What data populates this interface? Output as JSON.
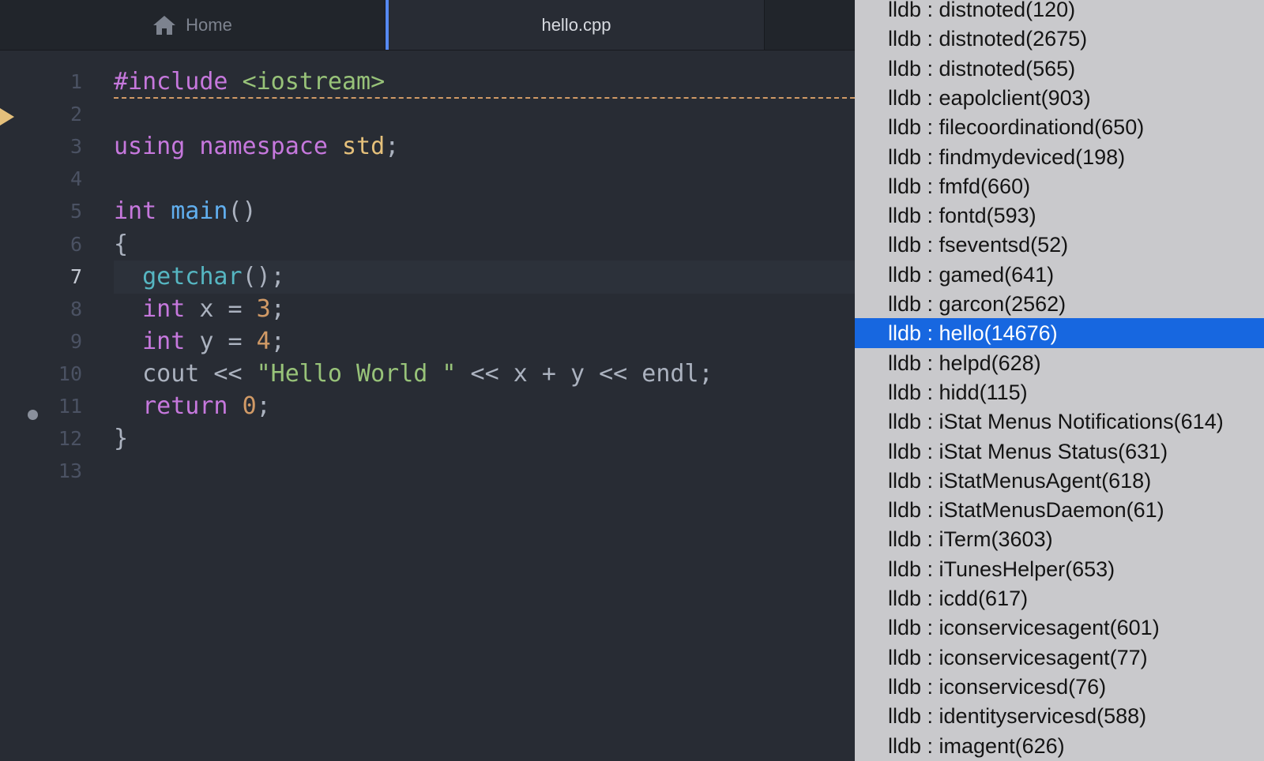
{
  "tabs": {
    "home_label": "Home",
    "file_label": "hello.cpp"
  },
  "editor": {
    "current_line": 7,
    "line_numbers": [
      "1",
      "2",
      "3",
      "4",
      "5",
      "6",
      "7",
      "8",
      "9",
      "10",
      "11",
      "12",
      "13"
    ],
    "lines": [
      [
        {
          "t": "#include ",
          "c": "kw"
        },
        {
          "t": "<iostream>",
          "c": "str"
        }
      ],
      [],
      [
        {
          "t": "using ",
          "c": "kw"
        },
        {
          "t": "namespace ",
          "c": "kw"
        },
        {
          "t": "std",
          "c": "ty"
        },
        {
          "t": ";",
          "c": "pl"
        }
      ],
      [],
      [
        {
          "t": "int ",
          "c": "kw"
        },
        {
          "t": "main",
          "c": "fn"
        },
        {
          "t": "()",
          "c": "pl"
        }
      ],
      [
        {
          "t": "{",
          "c": "pl"
        }
      ],
      [
        {
          "t": "  ",
          "c": "pl"
        },
        {
          "t": "getchar",
          "c": "bi"
        },
        {
          "t": "();",
          "c": "pl"
        }
      ],
      [
        {
          "t": "  ",
          "c": "pl"
        },
        {
          "t": "int",
          "c": "kw"
        },
        {
          "t": " x = ",
          "c": "pl"
        },
        {
          "t": "3",
          "c": "num"
        },
        {
          "t": ";",
          "c": "pl"
        }
      ],
      [
        {
          "t": "  ",
          "c": "pl"
        },
        {
          "t": "int",
          "c": "kw"
        },
        {
          "t": " y = ",
          "c": "pl"
        },
        {
          "t": "4",
          "c": "num"
        },
        {
          "t": ";",
          "c": "pl"
        }
      ],
      [
        {
          "t": "  cout << ",
          "c": "pl"
        },
        {
          "t": "\"Hello World \"",
          "c": "str"
        },
        {
          "t": " << x + y << endl;",
          "c": "pl"
        }
      ],
      [
        {
          "t": "  ",
          "c": "pl"
        },
        {
          "t": "return ",
          "c": "kw"
        },
        {
          "t": "0",
          "c": "num"
        },
        {
          "t": ";",
          "c": "pl"
        }
      ],
      [
        {
          "t": "}",
          "c": "pl"
        }
      ],
      []
    ]
  },
  "process_list": {
    "selected_index": 11,
    "items": [
      "lldb : distnoted(120)",
      "lldb : distnoted(2675)",
      "lldb : distnoted(565)",
      "lldb : eapolclient(903)",
      "lldb : filecoordinationd(650)",
      "lldb : findmydeviced(198)",
      "lldb : fmfd(660)",
      "lldb : fontd(593)",
      "lldb : fseventsd(52)",
      "lldb : gamed(641)",
      "lldb : garcon(2562)",
      "lldb : hello(14676)",
      "lldb : helpd(628)",
      "lldb : hidd(115)",
      "lldb : iStat Menus Notifications(614)",
      "lldb : iStat Menus Status(631)",
      "lldb : iStatMenusAgent(618)",
      "lldb : iStatMenusDaemon(61)",
      "lldb : iTerm(3603)",
      "lldb : iTunesHelper(653)",
      "lldb : icdd(617)",
      "lldb : iconservicesagent(601)",
      "lldb : iconservicesagent(77)",
      "lldb : iconservicesd(76)",
      "lldb : identityservicesd(588)",
      "lldb : imagent(626)"
    ]
  },
  "icons": {
    "home": "home-icon",
    "breakpoint_current": "debug-arrow-icon",
    "breakpoint": "breakpoint-dot-icon"
  },
  "colors": {
    "editor_bg": "#282c34",
    "list_bg": "#c9c9cc",
    "selection": "#1767e0",
    "tab_accent": "#568af2"
  }
}
